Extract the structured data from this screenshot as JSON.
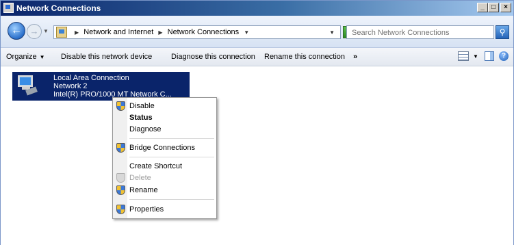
{
  "window": {
    "title": "Network Connections"
  },
  "address": {
    "breadcrumbs": [
      "Network and Internet",
      "Network Connections"
    ],
    "search_placeholder": "Search Network Connections"
  },
  "commands": {
    "organize": "Organize",
    "disable": "Disable this network device",
    "diagnose": "Diagnose this connection",
    "rename": "Rename this connection",
    "more": "»"
  },
  "connection": {
    "name": "Local Area Connection",
    "network": "Network  2",
    "adapter": "Intel(R) PRO/1000 MT Network C..."
  },
  "context_menu": {
    "items": [
      {
        "label": "Disable",
        "icon": "shield-icon"
      },
      {
        "label": "Status"
      },
      {
        "label": "Diagnose"
      },
      {
        "label": "Bridge Connections",
        "icon": "shield-icon"
      },
      {
        "label": "Create Shortcut"
      },
      {
        "label": "Delete",
        "icon": "shield-icon",
        "disabled": true
      },
      {
        "label": "Rename",
        "icon": "shield-icon"
      },
      {
        "label": "Properties",
        "icon": "shield-icon"
      }
    ]
  },
  "colors": {
    "selection": "#0a246a",
    "title_gradient_start": "#0a246a",
    "title_gradient_end": "#a6caf0"
  }
}
